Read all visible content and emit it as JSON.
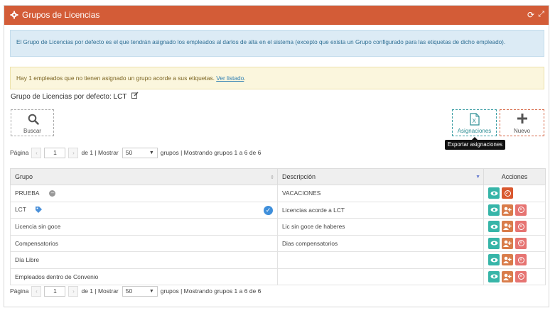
{
  "header": {
    "title": "Grupos de Licencias",
    "accent": "#d35c37"
  },
  "alerts": {
    "info": "El Grupo de Licencias por defecto es el que tendrán asignado los empleados al darlos de alta en el sistema (excepto que exista un Grupo configurado para las etiquetas de dicho empleado).",
    "warning_text": "Hay 1 empleados que no tienen asignado un grupo acorde a sus etiquetas. ",
    "warning_link": "Ver listado"
  },
  "default_group": {
    "label": "Grupo de Licencias por defecto: ",
    "value": "LCT"
  },
  "toolbar": {
    "search_label": "Buscar",
    "assign_label": "Asignaciones",
    "new_label": "Nuevo",
    "tooltip": "Exportar asignaciones"
  },
  "pager": {
    "page_label": "Página",
    "page": "1",
    "of_label": "de 1 | Mostrar",
    "page_size": "50",
    "summary": "grupos | Mostrando grupos 1 a 6 de 6",
    "prev": "‹",
    "next": "›"
  },
  "table": {
    "headers": [
      "Grupo",
      "Descripción",
      "Acciones"
    ],
    "rows": [
      {
        "grupo": "PRUEBA",
        "descripcion": "VACACIONES"
      },
      {
        "grupo": "LCT",
        "descripcion": "Licencias acorde a LCT"
      },
      {
        "grupo": "Licencia sin goce",
        "descripcion": "Lic sin goce de haberes"
      },
      {
        "grupo": "Compensatorios",
        "descripcion": "Dias compensatorios"
      },
      {
        "grupo": "Día Libre",
        "descripcion": ""
      },
      {
        "grupo": "Empleados dentro de Convenio",
        "descripcion": ""
      }
    ]
  },
  "icons": {
    "gear": "gear-icon",
    "refresh": "refresh-icon",
    "expand": "expand-icon",
    "search": "search-icon",
    "excel": "excel-icon",
    "plus": "plus-icon",
    "edit": "edit-icon",
    "view": "eye-icon",
    "users": "users-icon",
    "delete": "delete-icon",
    "check": "check-icon"
  }
}
